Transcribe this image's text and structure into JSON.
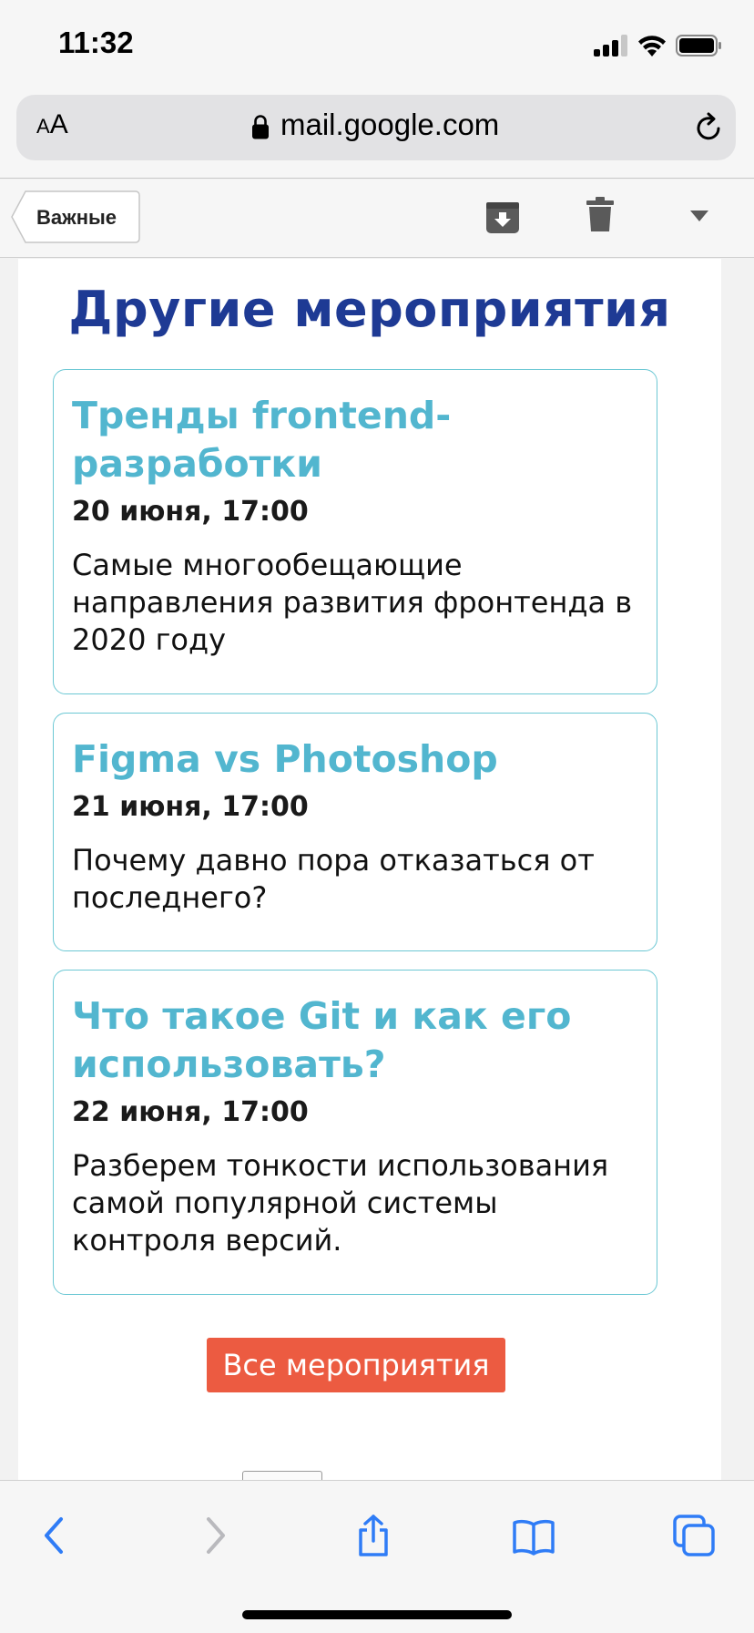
{
  "status_bar": {
    "time": "11:32"
  },
  "browser": {
    "text_size_small": "A",
    "text_size_large": "A",
    "url": "mail.google.com"
  },
  "gmail_toolbar": {
    "back_label": "Важные"
  },
  "email": {
    "section_title": "Другие мероприятия",
    "events": [
      {
        "title": "Тренды frontend-разработки",
        "date": "20 июня, 17:00",
        "description": "Самые многообещающие направления развития фронтенда в 2020 году"
      },
      {
        "title": "Figma vs Photoshop",
        "date": "21 июня, 17:00",
        "description": "Почему давно пора отказаться от последнего?"
      },
      {
        "title": "Что такое Git и как его использовать?",
        "date": "22 июня, 17:00",
        "description": "Разберем тонкости использования самой популярной системы контроля версий."
      }
    ],
    "cta_label": "Все мероприятия"
  },
  "colors": {
    "title_blue": "#1e3a94",
    "card_title_teal": "#52b6cf",
    "card_border": "#6cc8d4",
    "cta_red": "#ec5b41",
    "ios_blue": "#2f7cf6"
  }
}
